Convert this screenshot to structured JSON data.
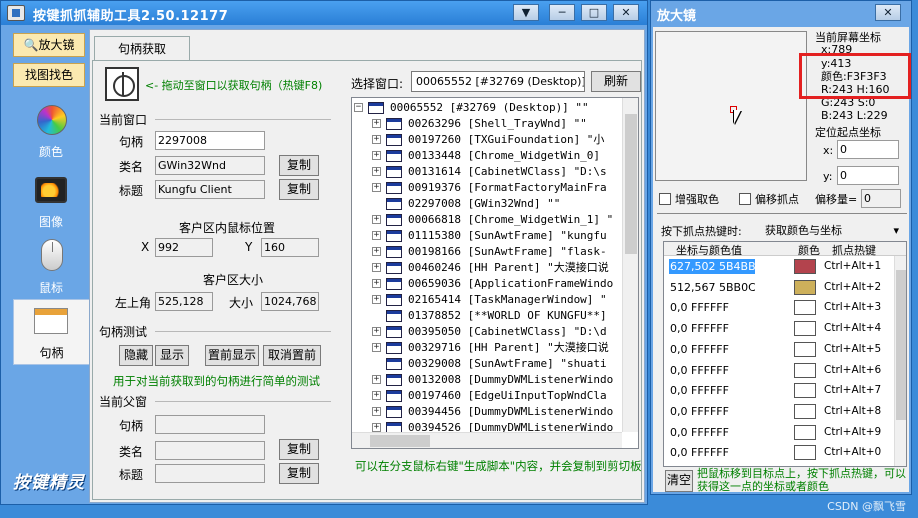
{
  "main": {
    "title": "按键抓抓辅助工具2.50.12177",
    "win_buttons": [
      "▼",
      "─",
      "□",
      "✕"
    ]
  },
  "sidebar": {
    "top_buttons": [
      "放大镜",
      "找图找色"
    ],
    "items": [
      {
        "label": "颜色",
        "icon": "color-wheel-icon"
      },
      {
        "label": "图像",
        "icon": "image-icon"
      },
      {
        "label": "鼠标",
        "icon": "mouse-icon"
      },
      {
        "label": "句柄",
        "icon": "window-handle-icon"
      }
    ],
    "logo": "按键精灵"
  },
  "panel": {
    "tab": "句柄获取",
    "drag_hint": "<- 拖动至窗口以获取句柄（热键F8)",
    "current_window": {
      "heading": "当前窗口",
      "handle_label": "句柄",
      "handle_value": "2297008",
      "class_label": "类名",
      "class_value": "GWin32Wnd",
      "title_label": "标题",
      "title_value": "Kungfu Client",
      "copy": "复制"
    },
    "client_mouse": {
      "heading": "客户区内鼠标位置",
      "x_label": "X",
      "x_value": "992",
      "y_label": "Y",
      "y_value": "160"
    },
    "client_size": {
      "heading": "客户区大小",
      "topleft_label": "左上角",
      "topleft_value": "525,128",
      "size_label": "大小",
      "size_value": "1024,768"
    },
    "handle_test": {
      "heading": "句柄测试",
      "buttons": [
        "隐藏",
        "显示",
        "置前显示",
        "取消置前"
      ],
      "hint": "用于对当前获取到的句柄进行简单的测试"
    },
    "parent_window": {
      "heading": "当前父窗",
      "handle_label": "句柄",
      "handle_value": "",
      "class_label": "类名",
      "class_value": "",
      "title_label": "标题",
      "title_value": "",
      "copy": "复制"
    },
    "select_window_label": "选择窗口:",
    "select_window_value": "00065552 [#32769 (Desktop)] \"\"",
    "refresh": "刷新",
    "tree": [
      "00065552 [#32769 (Desktop)] \"\"",
      "00263296 [Shell_TrayWnd] \"\"",
      "00197260 [TXGuiFoundation] \"小",
      "00133448 [Chrome_WidgetWin_0]",
      "00131614 [CabinetWClass] \"D:\\s",
      "00919376 [FormatFactoryMainFra",
      "02297008 [GWin32Wnd] \"\"",
      "00066818 [Chrome_WidgetWin_1] \"",
      "01115380 [SunAwtFrame] \"kungfu",
      "00198166 [SunAwtFrame] \"flask-",
      "00460246 [HH Parent] \"大漠接口说",
      "00659036 [ApplicationFrameWindo",
      "02165414 [TaskManagerWindow] \"",
      "01378852 [**WORLD OF KUNGFU**]",
      "00395050 [CabinetWClass] \"D:\\d",
      "00329716 [HH Parent] \"大漠接口说",
      "00329008 [SunAwtFrame] \"shuati",
      "00132008 [DummyDWMListenerWindo",
      "00197460 [EdgeUiInputTopWndCla",
      "00394456 [DummyDWMListenerWindo",
      "00394526 [DummyDWMListenerWindo"
    ],
    "bottom_hint": "可以在分支鼠标右键\"生成脚本\"内容，并会复制到剪切板"
  },
  "magnifier": {
    "title": "放大镜",
    "close": "✕",
    "screen_coord_label": "当前屏幕坐标",
    "x_text": "x:789",
    "y_text": "y:413",
    "color_text": "颜色:F3F3F3",
    "rh_text": "R:243  H:160",
    "gs_text": "G:243  S:0",
    "bl_text": "B:243  L:229",
    "origin_label": "定位起点坐标",
    "origin_x_label": "x:",
    "origin_x": "0",
    "origin_y_label": "y:",
    "origin_y": "0",
    "enhance_label": "增强取色",
    "offset_label": "偏移抓点",
    "offset_amount_label": "偏移量=",
    "offset_amount": "0",
    "hotkey_label": "按下抓点热键时:",
    "hotkey_value": "获取颜色与坐标",
    "col_coord": "坐标与颜色值",
    "col_color": "颜色",
    "col_hotkey": "抓点热键",
    "rows": [
      {
        "value": "627,502  5B4BB3",
        "color": "#b3434d",
        "hotkey": "Ctrl+Alt+1",
        "selected": true
      },
      {
        "value": "512,567  5BB0CD",
        "color": "#cdb05b",
        "hotkey": "Ctrl+Alt+2"
      },
      {
        "value": "0,0  FFFFFF",
        "color": "#ffffff",
        "hotkey": "Ctrl+Alt+3"
      },
      {
        "value": "0,0  FFFFFF",
        "color": "#ffffff",
        "hotkey": "Ctrl+Alt+4"
      },
      {
        "value": "0,0  FFFFFF",
        "color": "#ffffff",
        "hotkey": "Ctrl+Alt+5"
      },
      {
        "value": "0,0  FFFFFF",
        "color": "#ffffff",
        "hotkey": "Ctrl+Alt+6"
      },
      {
        "value": "0,0  FFFFFF",
        "color": "#ffffff",
        "hotkey": "Ctrl+Alt+7"
      },
      {
        "value": "0,0  FFFFFF",
        "color": "#ffffff",
        "hotkey": "Ctrl+Alt+8"
      },
      {
        "value": "0,0  FFFFFF",
        "color": "#ffffff",
        "hotkey": "Ctrl+Alt+9"
      },
      {
        "value": "0,0  FFFFFF",
        "color": "#ffffff",
        "hotkey": "Ctrl+Alt+0"
      }
    ],
    "clear": "清空",
    "bottom_hint": "把鼠标移到目标点上，按下抓点热键，可以获得这一点的坐标或者颜色"
  },
  "watermark": "CSDN @飘飞雪"
}
